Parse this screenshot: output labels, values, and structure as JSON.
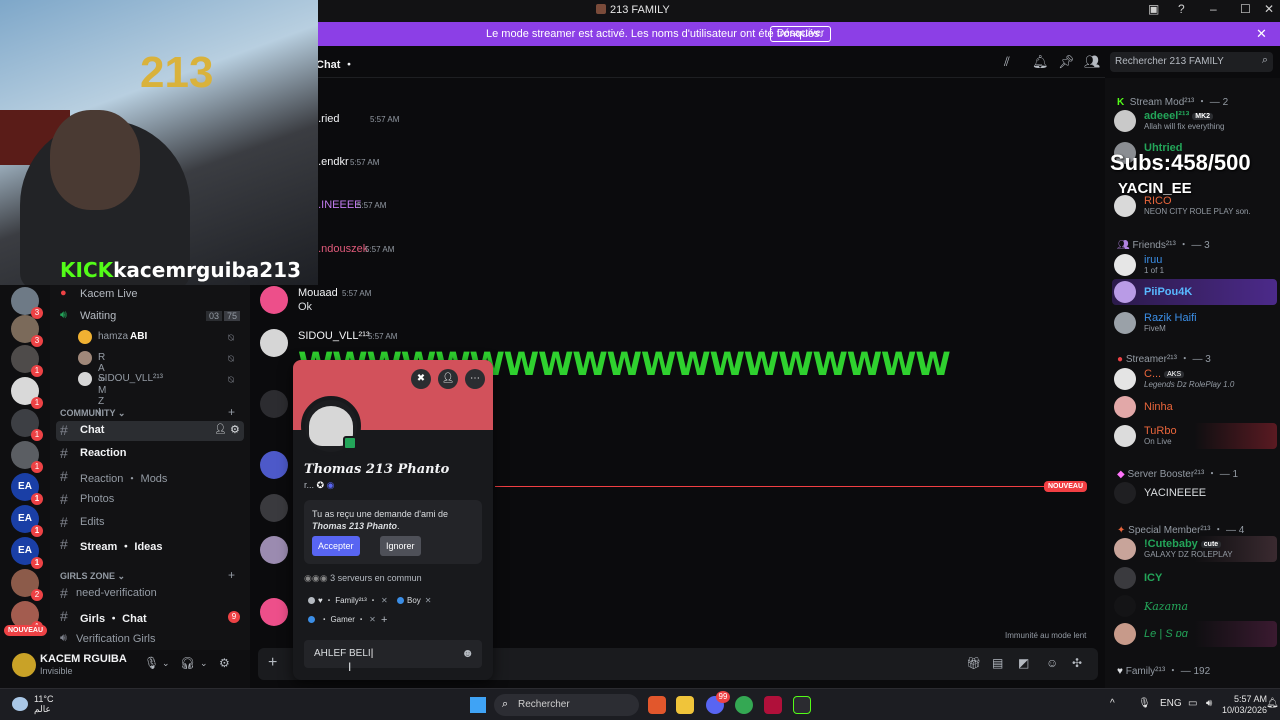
{
  "window": {
    "title": "213 FAMILY",
    "title_icon": "server-icon",
    "controls": [
      "profile-icon",
      "help-icon",
      "minimize-icon",
      "maximize-icon",
      "close-icon"
    ]
  },
  "banner": {
    "message": "Le mode streamer est activé. Les noms d'utilisateur ont été tronqués.",
    "button": "Désactiver",
    "color": "#8c3fe6"
  },
  "stream_overlay": {
    "kick_label": "KICK",
    "kick_user": "kacemrguiba213",
    "subs": "Subs:458/500",
    "sub_name": "YACIN_EE"
  },
  "server_rail": {
    "badges": [
      "3",
      "3",
      "1",
      "1",
      "1",
      "1",
      "1",
      "1",
      "1",
      "3",
      "2",
      "1"
    ],
    "new_label": "NOUVEAU"
  },
  "channels": {
    "voice": [
      {
        "name": "Kacem Live"
      },
      {
        "name": "Waiting",
        "count_a": "03",
        "count_b": "75"
      }
    ],
    "voice_users": [
      "hamza",
      "R A ∞ M Z I",
      "SIDOU_VLL²¹³"
    ],
    "voice_user_tag": "ABI",
    "community_label": "COMMUNITY",
    "community": [
      {
        "name": "Chat",
        "selected": true
      },
      {
        "name": "Reaction",
        "bold": true
      },
      {
        "name": "Reaction ・ Mods"
      },
      {
        "name": "Photos"
      },
      {
        "name": "Edits"
      },
      {
        "name": "Stream ・ Ideas",
        "bold": true
      }
    ],
    "girls_label": "GIRLS ZONE",
    "girls": [
      {
        "name": "need-verification"
      },
      {
        "name": "Girls ・ Chat",
        "bold": true,
        "badge": "9"
      },
      {
        "name": "Verification Girls"
      }
    ]
  },
  "user_panel": {
    "name": "KACEM RGUIBA",
    "status": "Invisible",
    "icons": [
      "microphone-icon",
      "chevron-down-icon",
      "headphones-icon",
      "chevron-down-icon",
      "settings-icon"
    ]
  },
  "chat_header": {
    "channel": "Chat ・",
    "icons": [
      "threads-icon",
      "bell-icon",
      "pin-icon",
      "members-icon"
    ],
    "search_placeholder": "Rechercher 213 FAMILY"
  },
  "messages": [
    {
      "author": "...ried",
      "time": "5:57 AM",
      "color": "#dbdee1"
    },
    {
      "author": "...endkr",
      "time": "5:57 AM",
      "color": "#dbdee1"
    },
    {
      "author": "...INEEEE",
      "time": "5:57 AM",
      "color": "#c27cf0"
    },
    {
      "author": "...ndouszek",
      "time": "5:57 AM",
      "color": "#e05a7a"
    },
    {
      "author": "Mouaad",
      "time": "5:57 AM",
      "text": "Ok",
      "color": "#dbdee1"
    },
    {
      "author": "SIDOU_VLL²¹³",
      "time": "5:57 AM",
      "color": "#dbdee1"
    }
  ],
  "big_message": "WWWWWWWWWWWWWWWWWWW",
  "new_marker": "NOUVEAU",
  "immunity": "Immunité au mode lent",
  "composer_icons": [
    "gift-icon",
    "gif-icon",
    "sticker-icon",
    "emoji-icon",
    "apps-icon"
  ],
  "profile_popup": {
    "name": "Thomas 213 Phanto",
    "subtitle": "r...",
    "request_text": "Tu as reçu une demande d'ami de",
    "request_name": "Thomas 213 Phanto",
    "accept": "Accepter",
    "ignore": "Ignorer",
    "mutual": "3 serveurs en commun",
    "roles": [
      {
        "name": "Family²¹³",
        "color": "#b5bac1"
      },
      {
        "name": "Boy",
        "color": "#3b8ee6"
      },
      {
        "name": "Gamer",
        "color": "#3b8ee6"
      }
    ],
    "reply_value": "AHLEF BELI",
    "banner_color": "#d2515b"
  },
  "members": {
    "groups": [
      {
        "label": "Stream Mod²¹³ ・ — 2"
      },
      {
        "label": "Friends²¹³ ・ — 3"
      },
      {
        "label": "Streamer²¹³ ・ — 3"
      },
      {
        "label": "Server Booster²¹³ ・ — 1"
      },
      {
        "label": "Special Member²¹³ ・ — 4"
      },
      {
        "label": "Family²¹³ ・ — 192"
      }
    ],
    "list": [
      {
        "name": "adeeel²¹³",
        "tag": "MK2",
        "sub": "Allah will fix everything",
        "color": "#23a559"
      },
      {
        "name": "Uhtried",
        "sub": "",
        "color": "#23a559"
      },
      {
        "name": "RICO",
        "sub": "NEON CITY ROLE PLAY son.",
        "color": "#e8653b"
      },
      {
        "name": "iruu",
        "sub": "1 of 1",
        "color": "#3b8ee6"
      },
      {
        "name": "PiiPou4K",
        "sub": "",
        "color": "#3b8ee6"
      },
      {
        "name": "Razik Haifi",
        "sub": "FiveM",
        "color": "#3b8ee6"
      },
      {
        "name": "C...",
        "tag": "AKS",
        "sub": "Legends Dz RolePlay 1.0",
        "color": "#e8653b"
      },
      {
        "name": "Ninha",
        "sub": "",
        "color": "#e8653b"
      },
      {
        "name": "TuRbo",
        "sub": "On Live",
        "color": "#e8653b"
      },
      {
        "name": "YACINEEEE",
        "sub": "",
        "color": "#dbdee1"
      },
      {
        "name": "!Cutebaby",
        "tag": "cute",
        "sub": "GALAXY DZ ROLEPLAY",
        "color": "#23a559"
      },
      {
        "name": "ICY",
        "sub": "",
        "color": "#23a559"
      },
      {
        "name": "Kazama",
        "sub": "",
        "color": "#23a559"
      },
      {
        "name": "Le | S ɒɑ",
        "sub": "",
        "color": "#23a559"
      }
    ]
  },
  "taskbar": {
    "temp": "11°C",
    "weather_text": "عالم",
    "search": "Rechercher",
    "lang": "ENG",
    "time": "5:57 AM",
    "date": "10/03/2026",
    "discord_badge": "99"
  }
}
